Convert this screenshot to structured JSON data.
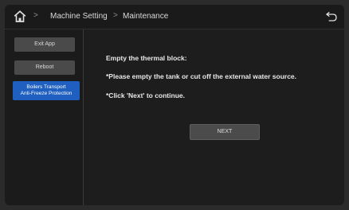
{
  "breadcrumb": {
    "items": [
      "Machine Setting",
      "Maintenance"
    ]
  },
  "sidebar": {
    "buttons": [
      {
        "label": "Exit App"
      },
      {
        "label": "Reboot"
      },
      {
        "label_line1": "Boilers Transport",
        "label_line2": "Anti-Freeze Protection",
        "active": true
      }
    ]
  },
  "main": {
    "title": "Empty the thermal block:",
    "line1": "*Please empty the tank or cut off the external water source.",
    "line2": "*Click 'Next' to continue.",
    "next_label": "NEXT"
  },
  "colors": {
    "accent": "#1f5fbf",
    "button": "#4a4a4a",
    "background": "#1d1d1d"
  }
}
